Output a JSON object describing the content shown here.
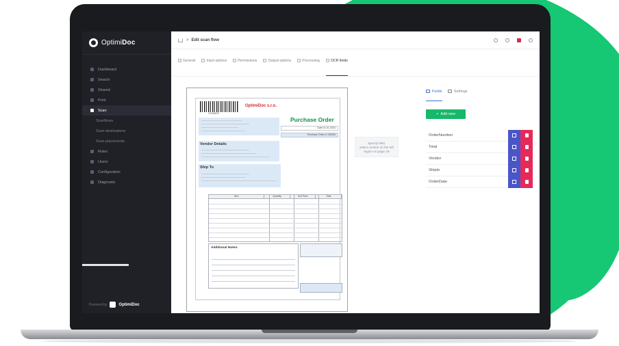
{
  "brand": {
    "name_light": "Optimi",
    "name_bold": "Doc",
    "accent": "#16c774"
  },
  "topbar": {
    "breadcrumb_sep": ">",
    "title": "Edit scan flow"
  },
  "sidebar": {
    "items": [
      {
        "label": "Dashboard"
      },
      {
        "label": "Search"
      },
      {
        "label": "Shared"
      },
      {
        "label": "Print"
      },
      {
        "label": "Scan",
        "active": true
      },
      {
        "label": "Scanflows",
        "sub": true
      },
      {
        "label": "Scan destinations",
        "sub": true
      },
      {
        "label": "Scan placements",
        "sub": true
      },
      {
        "label": "Rules"
      },
      {
        "label": "Users"
      },
      {
        "label": "Configuration"
      },
      {
        "label": "Diagnostic"
      }
    ],
    "powered_label": "Powered by",
    "powered_brand": "OptimiDoc"
  },
  "tabs": [
    {
      "label": "General"
    },
    {
      "label": "Input options"
    },
    {
      "label": "Permissions"
    },
    {
      "label": "Output options"
    },
    {
      "label": "Processing"
    },
    {
      "label": "OCR fields",
      "active": true
    }
  ],
  "document": {
    "barcode_number": "12345678",
    "company": "OptimiDoc s.r.o.",
    "title": "Purchase Order",
    "meta": [
      "Date 01.01.2024",
      "Purchase Order # 100054"
    ],
    "vendor_head": "Vendor Details",
    "ship_head": "Ship To",
    "table_headers": [
      "Item",
      "Quantity",
      "Unit Price",
      "Total"
    ],
    "notes_label": "Additional Notes:"
  },
  "hint": {
    "line1": "Specify field,",
    "line2": "select content on the left",
    "line3": "region on page 1R"
  },
  "right_panel": {
    "tabs": [
      {
        "label": "Fields",
        "active": true
      },
      {
        "label": "Settings"
      }
    ],
    "add_button": "Add new",
    "fields": [
      {
        "name": "OrderNumber"
      },
      {
        "name": "Total"
      },
      {
        "name": "Vendor"
      },
      {
        "name": "Shipto"
      },
      {
        "name": "OrderDate"
      }
    ],
    "edit_color": "#4a55c9",
    "delete_color": "#e52a5a"
  }
}
